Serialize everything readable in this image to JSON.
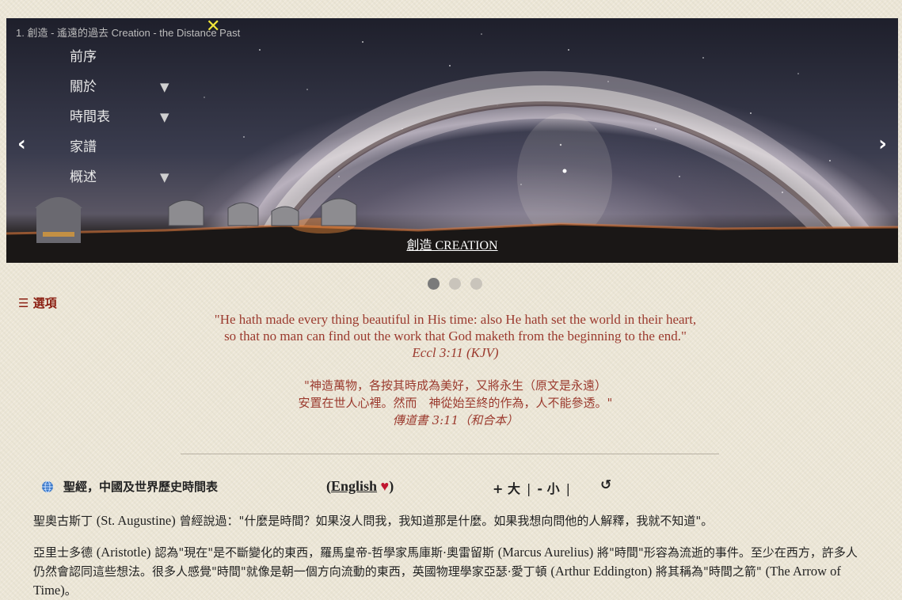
{
  "slideshow": {
    "caption": "1. 創造 - 遙遠的過去 Creation - the Distance Past",
    "close_icon": "close-x-icon",
    "close_symbol": "✕",
    "menu": [
      {
        "label": "前序",
        "has_dropdown": false
      },
      {
        "label": "關於",
        "has_dropdown": true
      },
      {
        "label": "時間表",
        "has_dropdown": true
      },
      {
        "label": "家譜",
        "has_dropdown": false
      },
      {
        "label": "概述",
        "has_dropdown": true
      }
    ],
    "dropdown_symbol": "▼",
    "prev_symbol": "‹",
    "next_symbol": "›",
    "title": "創造 CREATION",
    "dots": {
      "count": 3,
      "active": 0
    }
  },
  "options_label": "☰ 選項",
  "quote_en": {
    "line1": "\"He hath made every thing beautiful in His time: also He hath set the world in their heart,",
    "line2": "so that no man can find out the work that God maketh from the beginning to the end.\"",
    "ref": "Eccl 3:11 (KJV)"
  },
  "quote_zh": {
    "line1": "\"神造萬物，各按其時成為美好，又將永生（原文是永遠）",
    "line2": "安置在世人心裡。然而　神從始至終的作為，人不能參透。\"",
    "ref": "傳道書 3:11（和合本）"
  },
  "toolbar": {
    "globe_icon": "globe-icon",
    "title": "聖經，中國及世界歷史時間表",
    "lang_open": "(",
    "lang_link": "English",
    "lang_heart": "♥",
    "lang_close": ")",
    "font_bigger": "+ 大",
    "separator": "|",
    "font_smaller": "- 小",
    "reset_symbol": "↺"
  },
  "paragraphs": {
    "p1_a": "聖奧古斯丁",
    "p1_b": "(St. Augustine)",
    "p1_c": "曾經說過：\"什麼是時間？如果沒人問我，我知道那是什麼。如果我想向問他的人解釋，我就不知道\"。",
    "p2_a": "亞里士多德",
    "p2_b": "(Aristotle)",
    "p2_c": "認為\"現在\"是不斷變化的東西，羅馬皇帝-哲學家馬庫斯·奧雷留斯",
    "p2_d": "(Marcus Aurelius)",
    "p2_e": "將\"時間\"形容為流逝的事件。至少在西方，許多人仍然會認同這些想法。很多人感覺\"時間\"就像是朝一個方向流動的東西，英國物理學家亞瑟·愛丁頓",
    "p2_f": "(Arthur Eddington)",
    "p2_g": "將其稱為\"時間之箭\"",
    "p2_h": "(The Arrow of Time)",
    "p2_i": "。"
  }
}
